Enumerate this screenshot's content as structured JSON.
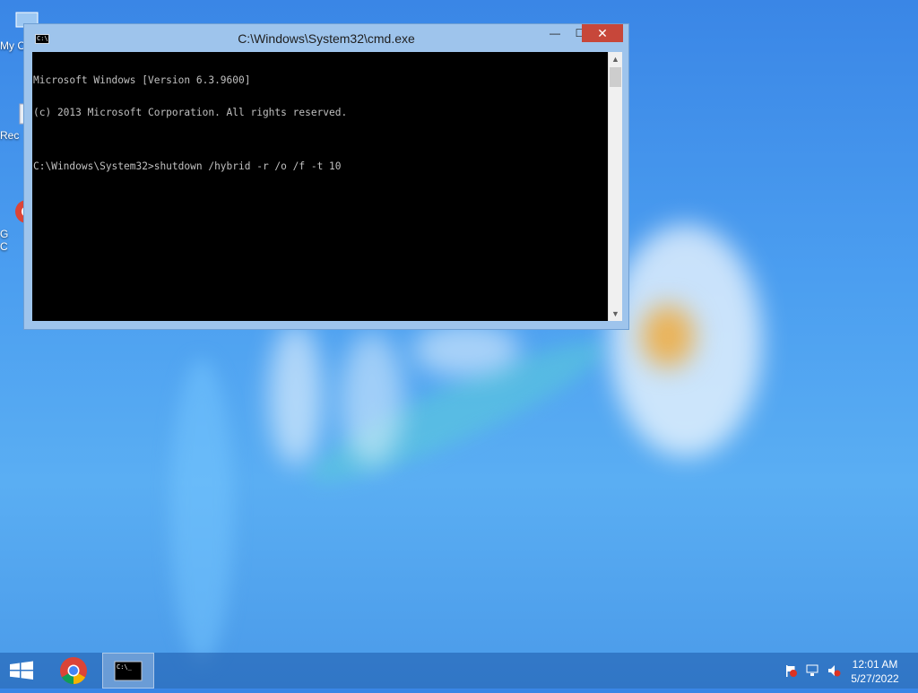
{
  "desktop": {
    "icons": [
      {
        "label": "My C",
        "icon": "computer-icon"
      },
      {
        "label": "Rec",
        "icon": "recycle-bin-icon"
      },
      {
        "label": "G\nC",
        "icon": "chrome-icon"
      }
    ]
  },
  "window": {
    "title": "C:\\Windows\\System32\\cmd.exe",
    "controls": {
      "minimize": "—",
      "maximize": "☐",
      "close": "✕"
    },
    "console_lines": [
      "Microsoft Windows [Version 6.3.9600]",
      "(c) 2013 Microsoft Corporation. All rights reserved.",
      "",
      "C:\\Windows\\System32>shutdown /hybrid -r /o /f -t 10"
    ],
    "scroll": {
      "up": "▲",
      "down": "▼"
    }
  },
  "taskbar": {
    "start_icon": "windows-start-icon",
    "pinned": [
      {
        "name": "Google Chrome",
        "icon": "chrome-icon"
      },
      {
        "name": "Command Prompt",
        "icon": "cmd-icon",
        "active": true
      }
    ],
    "tray": [
      "action-center-flag-icon",
      "network-icon",
      "volume-muted-icon"
    ],
    "time": "12:01 AM",
    "date": "5/27/2022"
  },
  "colors": {
    "accent_close": "#c7473a",
    "console_bg": "#000000",
    "console_fg": "#c0c0c0",
    "desktop_blue": "#4b9ef0"
  }
}
